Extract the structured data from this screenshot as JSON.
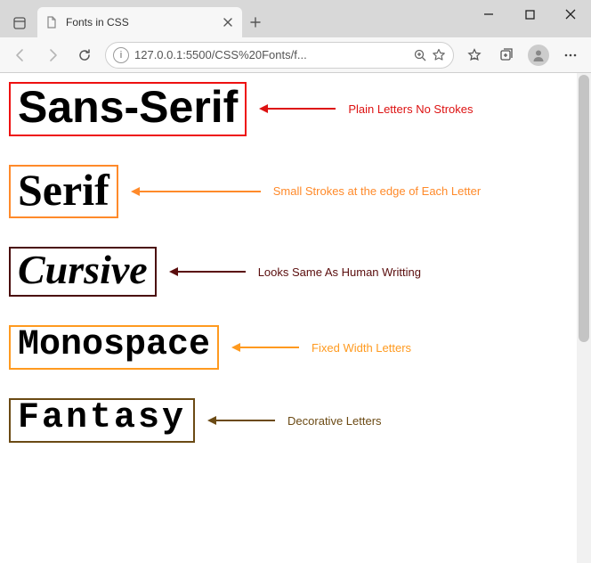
{
  "window": {
    "tab_title": "Fonts in CSS",
    "url": "127.0.0.1:5500/CSS%20Fonts/f..."
  },
  "fonts": {
    "sans": {
      "label": "Sans-Serif",
      "desc": "Plain Letters No Strokes",
      "color": "#d11"
    },
    "serif": {
      "label": "Serif",
      "desc": "Small Strokes at the edge of Each Letter",
      "color": "#ff8a2a"
    },
    "cursive": {
      "label": "Cursive",
      "desc": "Looks Same As Human Writting",
      "color": "#5a0d0d"
    },
    "mono": {
      "label": "Monospace",
      "desc": "Fixed Width Letters",
      "color": "#ff9a1f"
    },
    "fantasy": {
      "label": "Fantasy",
      "desc": "Decorative Letters",
      "color": "#6b4a14"
    }
  }
}
